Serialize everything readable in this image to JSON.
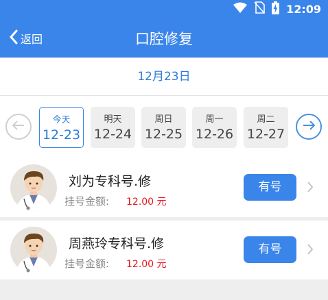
{
  "status_bar": {
    "time": "12:09",
    "icons": [
      "wifi-icon",
      "no-sim-icon",
      "battery-charging-icon"
    ]
  },
  "app_bar": {
    "back_label": "返回",
    "title": "口腔修复"
  },
  "selected_date_label": "12月23日",
  "days": [
    {
      "week": "今天",
      "date": "12-23",
      "selected": true
    },
    {
      "week": "明天",
      "date": "12-24",
      "selected": false
    },
    {
      "week": "周日",
      "date": "12-25",
      "selected": false
    },
    {
      "week": "周一",
      "date": "12-26",
      "selected": false
    },
    {
      "week": "周二",
      "date": "12-27",
      "selected": false
    }
  ],
  "doctors": [
    {
      "name": "刘为专科号.修",
      "fee_label": "挂号金额:",
      "fee": "12.00 元",
      "button": "有号"
    },
    {
      "name": "周燕玲专科号.修",
      "fee_label": "挂号金额:",
      "fee": "12.00 元",
      "button": "有号"
    }
  ],
  "colors": {
    "primary": "#3a85ea",
    "date_text": "#2d7bd8",
    "price": "#e8141b",
    "background": "#eeeeee"
  }
}
